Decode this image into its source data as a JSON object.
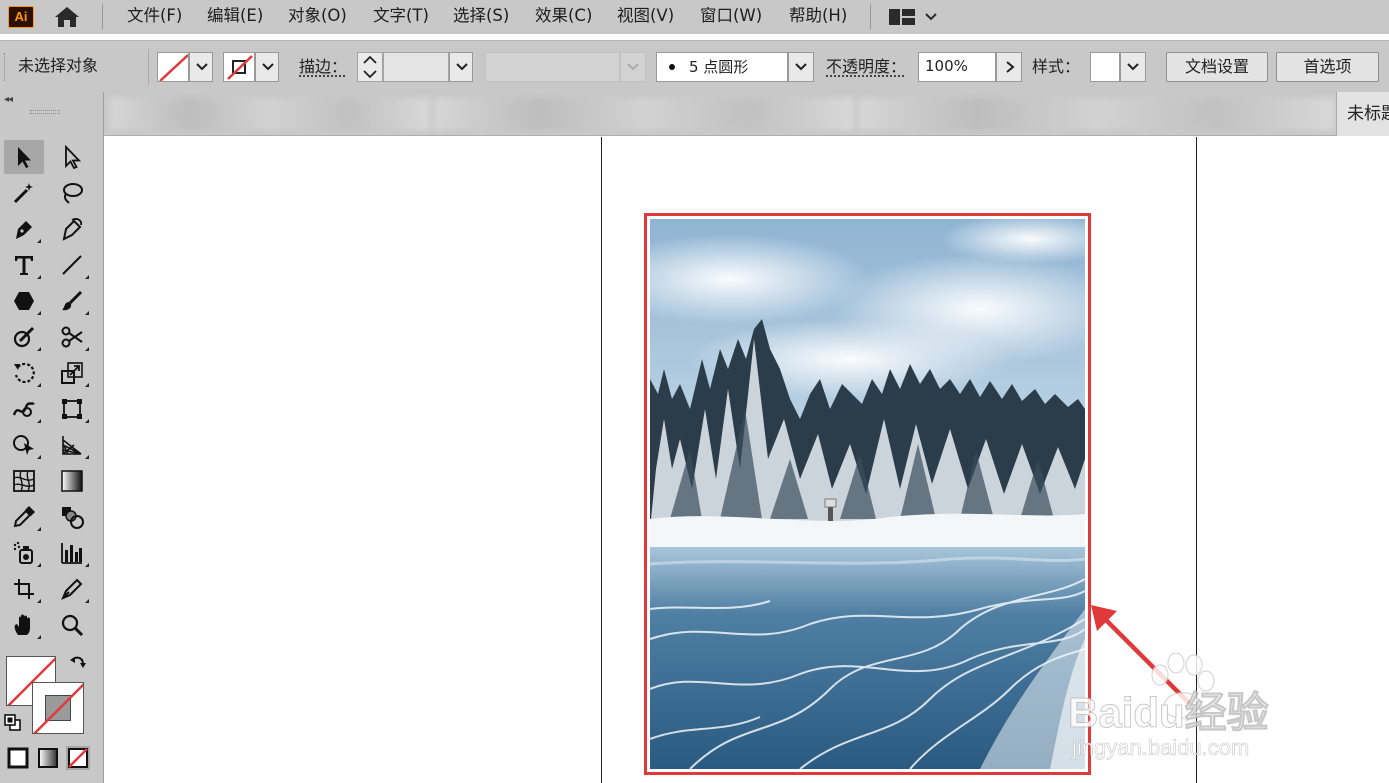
{
  "app": {
    "logo_text": "Ai"
  },
  "menu": {
    "items": [
      "文件(F)",
      "编辑(E)",
      "对象(O)",
      "文字(T)",
      "选择(S)",
      "效果(C)",
      "视图(V)",
      "窗口(W)",
      "帮助(H)"
    ]
  },
  "control_bar": {
    "selection_status": "未选择对象",
    "stroke_label": "描边：",
    "brush_value": "5 点圆形",
    "opacity_label": "不透明度：",
    "opacity_value": "100%",
    "style_label": "样式：",
    "doc_setup_label": "文档设置",
    "preferences_label": "首选项"
  },
  "tabs": {
    "active_title": "未标题"
  },
  "tools": [
    "selection",
    "direct-selection",
    "magic-wand",
    "lasso",
    "pen",
    "curvature",
    "type",
    "line-segment",
    "polygon",
    "paintbrush",
    "shaper",
    "scissors",
    "rotate",
    "scale",
    "warp",
    "free-transform",
    "shape-builder",
    "perspective-grid",
    "mesh",
    "gradient",
    "eyedropper",
    "blend",
    "symbol-sprayer",
    "column-graph",
    "artboard",
    "slice",
    "hand",
    "zoom"
  ],
  "colors": {
    "accent_red": "#e0393b",
    "chrome_gray": "#c8c8c8"
  },
  "watermark": {
    "brand": "Baidu经验",
    "url": "jingyan.baidu.com"
  }
}
